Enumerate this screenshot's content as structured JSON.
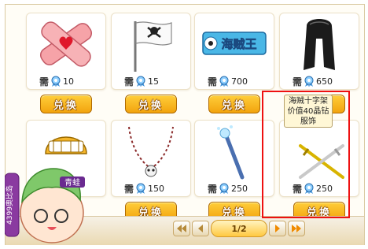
{
  "items": [
    {
      "name": "bandage",
      "need": "需",
      "price": "10",
      "button": "兑换"
    },
    {
      "name": "pirate-flag",
      "need": "需",
      "price": "15",
      "button": "兑换"
    },
    {
      "name": "one-piece-logo",
      "need": "需",
      "price": "700",
      "button": "兑换",
      "logo_text": "海贼王"
    },
    {
      "name": "black-wig",
      "need": "需",
      "price": "650",
      "button": "兑换"
    },
    {
      "name": "gold-helmet",
      "need": "",
      "price": "",
      "button": ""
    },
    {
      "name": "skull-necklace",
      "need": "需",
      "price": "150",
      "button": "兑换"
    },
    {
      "name": "wand",
      "need": "需",
      "price": "250",
      "button": "兑换"
    },
    {
      "name": "pirate-cross-rack",
      "need": "需",
      "price": "250",
      "button": "兑换"
    }
  ],
  "tooltip": {
    "line1": "海贼十字架",
    "line2": "价值40晶钻",
    "line3": "服饰"
  },
  "pager": {
    "indicator": "1/2"
  },
  "mascot": {
    "badge_text": "4399奥比岛",
    "tag_text": "青蛙"
  },
  "colors": {
    "highlight": "#e11111",
    "button": "#f2a30e"
  }
}
